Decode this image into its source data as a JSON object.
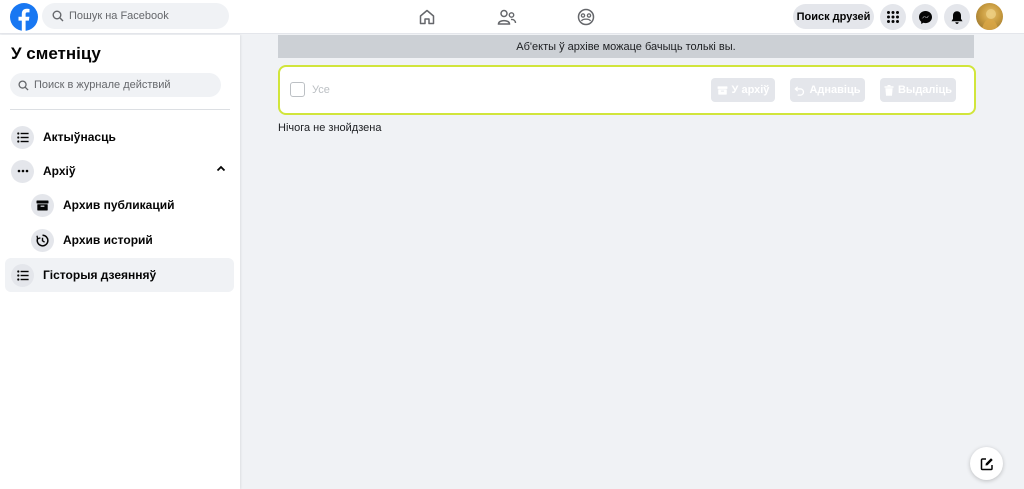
{
  "header": {
    "search_placeholder": "Пошук на Facebook",
    "find_friends_label": "Поиск друзей",
    "brand_color": "#1877f2"
  },
  "sidebar": {
    "title": "У сметніцу",
    "search_placeholder": "Поиск в журнале действий",
    "items": [
      {
        "label": "Актыўнасць",
        "icon": "list-icon"
      },
      {
        "label": "Архіў",
        "icon": "more-dots-icon",
        "expanded": true
      },
      {
        "label": "Архив публикаций",
        "icon": "archive-box-icon"
      },
      {
        "label": "Архив историй",
        "icon": "clock-history-icon"
      },
      {
        "label": "Гісторыя дзеянняў",
        "icon": "list-icon",
        "active": true
      }
    ]
  },
  "main": {
    "banner_text": "Аб'екты ў архіве можаце бачыць толькі вы.",
    "select_all_label": "Усе",
    "actions": [
      {
        "label": "У архіў",
        "icon": "archive-icon"
      },
      {
        "label": "Аднавіць",
        "icon": "restore-icon"
      },
      {
        "label": "Выдаліць",
        "icon": "trash-icon"
      }
    ],
    "empty_text": "Нічога не знойдзена",
    "highlight_color": "#d1e53b"
  }
}
